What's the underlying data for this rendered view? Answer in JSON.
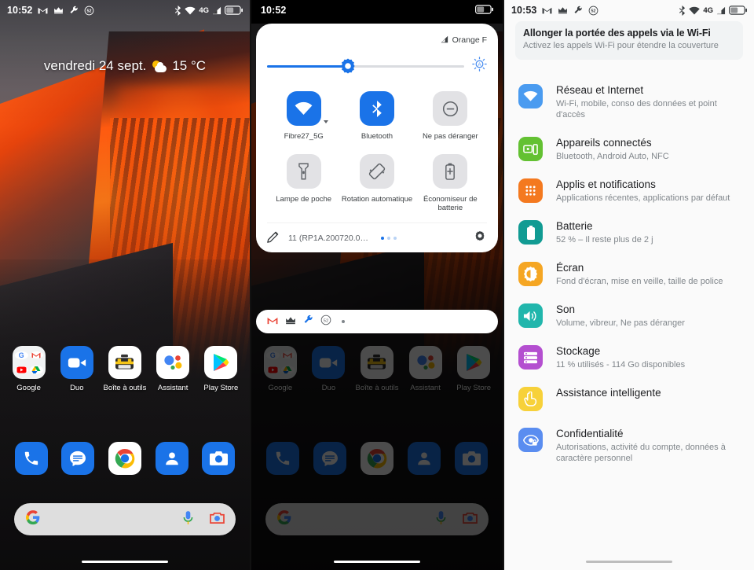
{
  "panel_home": {
    "statusbar": {
      "time": "10:52",
      "left_icons": [
        "gmail-icon",
        "crown-icon",
        "wrench-icon",
        "counter-52-icon"
      ],
      "right_icons": [
        "bluetooth-icon",
        "wifi-icon",
        "4g-icon",
        "signal-icon",
        "battery-icon"
      ],
      "network_label": "4G"
    },
    "date_widget": {
      "date": "vendredi 24 sept.",
      "temperature": "15 °C",
      "weather_icon": "partly-cloudy-icon"
    },
    "apps": [
      {
        "label": "Google",
        "icon": "google-folder-icon"
      },
      {
        "label": "Duo",
        "icon": "duo-icon"
      },
      {
        "label": "Boîte à outils",
        "icon": "toolbox-icon"
      },
      {
        "label": "Assistant",
        "icon": "google-assistant-icon"
      },
      {
        "label": "Play Store",
        "icon": "play-store-icon"
      }
    ],
    "dock": [
      {
        "label": "Téléphone",
        "icon": "phone-icon"
      },
      {
        "label": "Messages",
        "icon": "messages-icon"
      },
      {
        "label": "Chrome",
        "icon": "chrome-icon"
      },
      {
        "label": "Contacts",
        "icon": "contacts-icon"
      },
      {
        "label": "Appareil photo",
        "icon": "camera-icon"
      }
    ],
    "search": {
      "logo": "google-g-icon",
      "mic": "microphone-icon",
      "lens": "google-lens-icon",
      "placeholder": ""
    }
  },
  "panel_quicksettings": {
    "statusbar": {
      "time": "10:52",
      "right_icons": [
        "battery-icon"
      ]
    },
    "carrier": {
      "label": "Orange F",
      "icon": "signal-icon"
    },
    "brightness": {
      "value_percent": 41,
      "icon": "auto-brightness-icon"
    },
    "tiles": [
      {
        "label": "Fibre27_5G",
        "icon": "wifi-icon",
        "state": "on",
        "has_caret": true
      },
      {
        "label": "Bluetooth",
        "icon": "bluetooth-icon",
        "state": "on",
        "has_caret": false
      },
      {
        "label": "Ne pas déranger",
        "icon": "do-not-disturb-icon",
        "state": "off",
        "has_caret": false
      },
      {
        "label": "Lampe de poche",
        "icon": "flashlight-icon",
        "state": "off",
        "has_caret": false
      },
      {
        "label": "Rotation automatique",
        "icon": "auto-rotate-icon",
        "state": "off",
        "has_caret": false
      },
      {
        "label": "Économiseur de batterie",
        "icon": "battery-saver-icon",
        "state": "off",
        "has_caret": false
      }
    ],
    "footer": {
      "edit_icon": "pencil-icon",
      "build": "11 (RP1A.200720.0…",
      "settings_icon": "gear-icon",
      "page_dots": 3,
      "active_dot": 1
    },
    "notification_pill": {
      "icons": [
        "gmail-icon",
        "crown-icon",
        "wrench-icon",
        "counter-52-icon",
        "dot-icon"
      ]
    }
  },
  "panel_settings": {
    "statusbar": {
      "time": "10:53",
      "left_icons": [
        "gmail-icon",
        "crown-icon",
        "wrench-icon",
        "counter-52-icon"
      ],
      "right_icons": [
        "bluetooth-icon",
        "wifi-icon",
        "4g-icon",
        "signal-icon",
        "battery-icon"
      ],
      "network_label": "4G"
    },
    "suggestion": {
      "title": "Allonger la portée des appels via le Wi-Fi",
      "subtitle": "Activez les appels Wi-Fi pour étendre la couverture"
    },
    "items": [
      {
        "title": "Réseau et Internet",
        "subtitle": "Wi-Fi, mobile, conso des données et point d'accès",
        "icon": "wifi-icon",
        "color": "#4a9bf0"
      },
      {
        "title": "Appareils connectés",
        "subtitle": "Bluetooth, Android Auto, NFC",
        "icon": "connected-devices-icon",
        "color": "#63c132"
      },
      {
        "title": "Applis et notifications",
        "subtitle": "Applications récentes, applications par défaut",
        "icon": "apps-grid-icon",
        "color": "#f4791f"
      },
      {
        "title": "Batterie",
        "subtitle": "52 % – Il reste plus de 2 j",
        "icon": "battery-icon",
        "color": "#119b93"
      },
      {
        "title": "Écran",
        "subtitle": "Fond d'écran, mise en veille, taille de police",
        "icon": "brightness-icon",
        "color": "#f5a623"
      },
      {
        "title": "Son",
        "subtitle": "Volume, vibreur, Ne pas déranger",
        "icon": "speaker-icon",
        "color": "#21b6ac"
      },
      {
        "title": "Stockage",
        "subtitle": "11 % utilisés - 114 Go disponibles",
        "icon": "storage-list-icon",
        "color": "#b44fd0"
      },
      {
        "title": "Assistance intelligente",
        "subtitle": "",
        "icon": "pointing-hand-icon",
        "color": "#f7d13a"
      },
      {
        "title": "Confidentialité",
        "subtitle": "Autorisations, activité du compte, données à caractère personnel",
        "icon": "privacy-eye-icon",
        "color": "#5a8df0"
      }
    ]
  }
}
